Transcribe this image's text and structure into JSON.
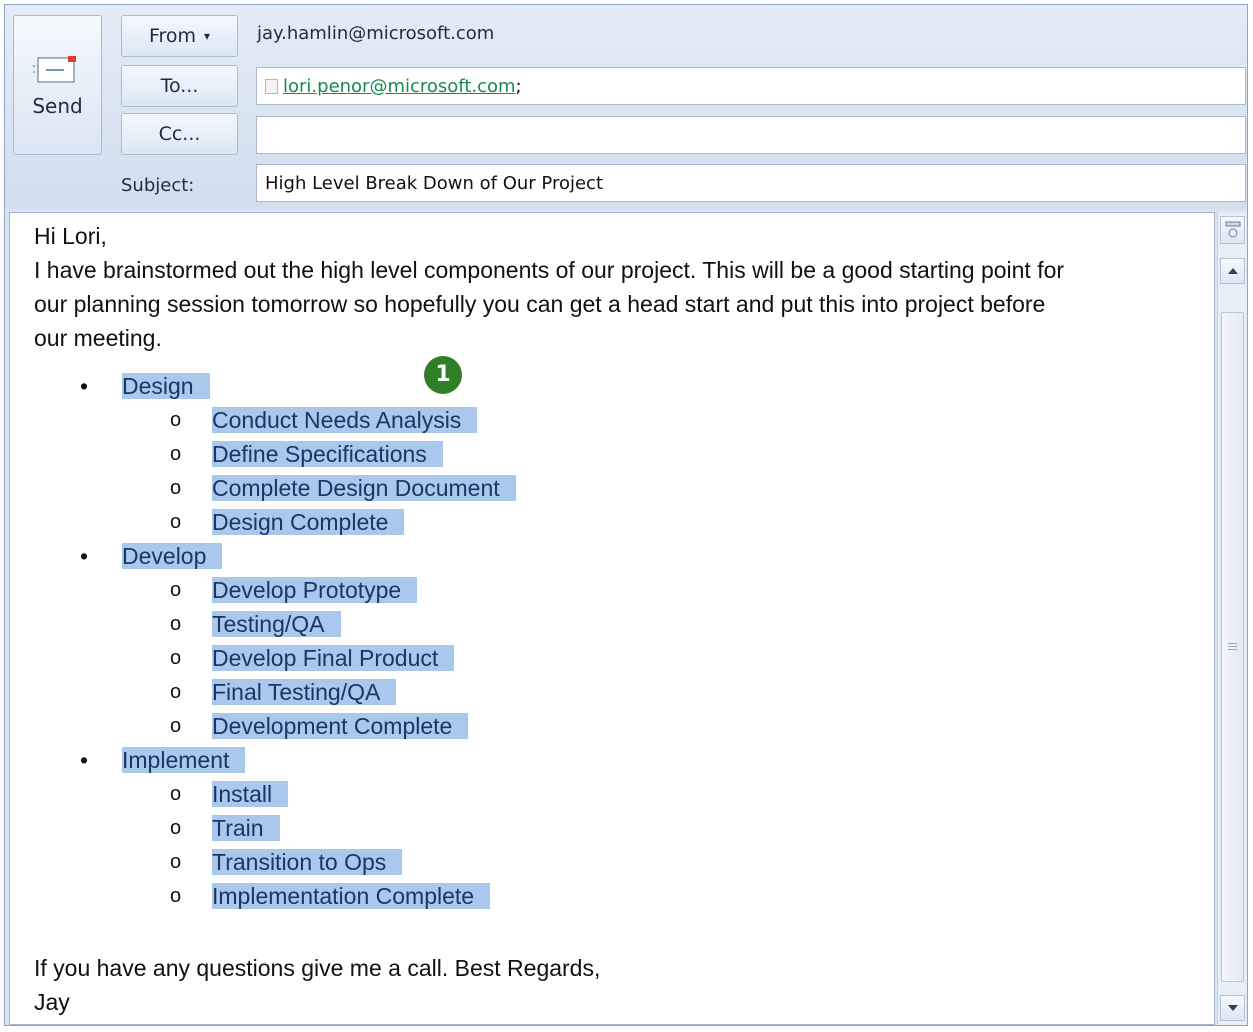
{
  "header": {
    "send_label": "Send",
    "from_label": "From",
    "from_arrow": "▾",
    "from_value": "jay.hamlin@microsoft.com",
    "to_label": "To...",
    "to_value": "lori.penor@microsoft.com",
    "to_separator": ";",
    "cc_label": "Cc...",
    "cc_value": "",
    "subject_label": "Subject:",
    "subject_value": "High Level Break Down of Our Project"
  },
  "body": {
    "greeting": "Hi Lori,",
    "intro_line1": "I have brainstormed out the high level components of our project.  This will be a good starting point for",
    "intro_line2": "our planning session tomorrow so hopefully you can get a head start and put this into project before",
    "intro_line3": "our meeting.",
    "outline": [
      {
        "label": "Design",
        "children": [
          "Conduct Needs Analysis",
          "Define Specifications",
          "Complete Design Document",
          "Design Complete"
        ]
      },
      {
        "label": "Develop",
        "children": [
          "Develop Prototype",
          "Testing/QA",
          "Develop Final Product",
          "Final Testing/QA",
          "Development Complete"
        ]
      },
      {
        "label": "Implement",
        "children": [
          "Install",
          "Train",
          "Transition to Ops",
          "Implementation Complete"
        ]
      }
    ],
    "closing_line": "If you have any questions give me a call.  Best Regards,",
    "signature": "Jay",
    "bullet_level1": "•",
    "bullet_level2": "o"
  },
  "callout_badge": "1",
  "colors": {
    "selection_highlight": "#aac8ec",
    "callout_green": "#2f7f28",
    "link_green": "#1b8a4a"
  }
}
